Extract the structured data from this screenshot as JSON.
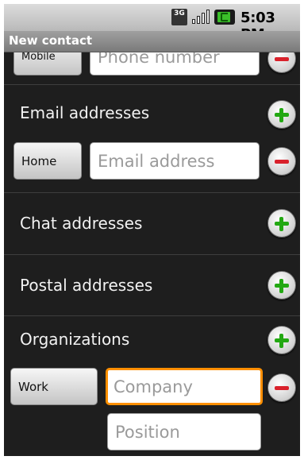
{
  "status_bar": {
    "network_label": "3G",
    "signal_bars": 4,
    "battery_color": "#3bbf2a",
    "time": "5:03 PM"
  },
  "title_bar": {
    "title": "New contact"
  },
  "phone_row": {
    "type_label": "Mobile",
    "placeholder": "Phone number"
  },
  "email": {
    "header": "Email addresses",
    "row": {
      "type_label": "Home",
      "placeholder": "Email address"
    }
  },
  "chat": {
    "header": "Chat addresses"
  },
  "postal": {
    "header": "Postal addresses"
  },
  "organizations": {
    "header": "Organizations",
    "row": {
      "type_label": "Work",
      "company_placeholder": "Company",
      "position_placeholder": "Position"
    }
  },
  "colors": {
    "add": "#23a812",
    "remove": "#d9212b",
    "focus": "#ff8f00"
  }
}
